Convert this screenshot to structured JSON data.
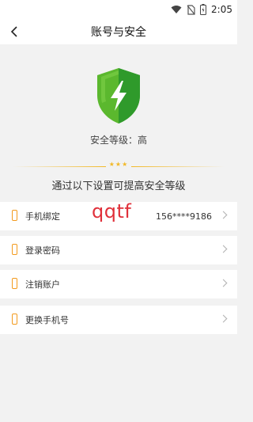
{
  "status_bar": {
    "time": "2:05"
  },
  "header": {
    "title": "账号与安全"
  },
  "security": {
    "level_label": "安全等级：高"
  },
  "hint": {
    "text": "通过以下设置可提高安全等级"
  },
  "divider": {
    "stars": "★★★"
  },
  "list": [
    {
      "label": "手机绑定",
      "value": "156****9186",
      "icon": "phone-icon"
    },
    {
      "label": "登录密码",
      "value": "",
      "icon": "phone-icon"
    },
    {
      "label": "注销账户",
      "value": "",
      "icon": "phone-icon"
    },
    {
      "label": "更换手机号",
      "value": "",
      "icon": "phone-icon"
    }
  ],
  "overlay": {
    "text": "qqtf"
  },
  "colors": {
    "accent": "#f39a1d",
    "shield_green": "#5bb82e",
    "star_gold": "#f2b928",
    "overlay_red": "#e0303a"
  }
}
